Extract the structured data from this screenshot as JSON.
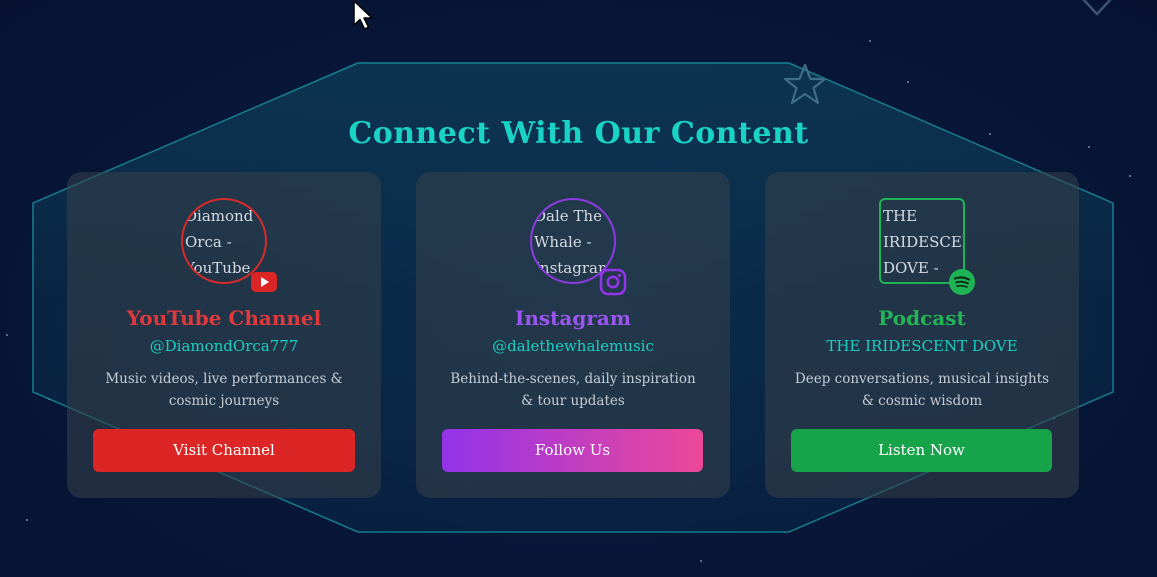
{
  "section": {
    "title": "Connect With Our Content"
  },
  "colors": {
    "title": "#19d3c5",
    "youtube": "#dc2626",
    "instagram_start": "#9333ea",
    "instagram_end": "#ec4899",
    "podcast": "#16a34a",
    "handle": "#19cfc1"
  },
  "cards": [
    {
      "avatar_alt_lines": [
        "Diamond",
        "Orca -",
        "YouTube"
      ],
      "badge_icon": "youtube-icon",
      "platform": "YouTube Channel",
      "handle": "@DiamondOrca777",
      "description": "Music videos, live performances & cosmic journeys",
      "button_label": "Visit Channel"
    },
    {
      "avatar_alt_lines": [
        "Dale The",
        "Whale -",
        "Instagram"
      ],
      "badge_icon": "instagram-icon",
      "platform": "Instagram",
      "handle": "@dalethewhalemusic",
      "description": "Behind-the-scenes, daily inspiration & tour updates",
      "button_label": "Follow Us"
    },
    {
      "avatar_alt_lines": [
        "THE",
        "IRIDESCENT",
        "DOVE -"
      ],
      "badge_icon": "spotify-icon",
      "platform": "Podcast",
      "handle": "THE IRIDESCENT DOVE",
      "description": "Deep conversations, musical insights & cosmic wisdom",
      "button_label": "Listen Now"
    }
  ]
}
